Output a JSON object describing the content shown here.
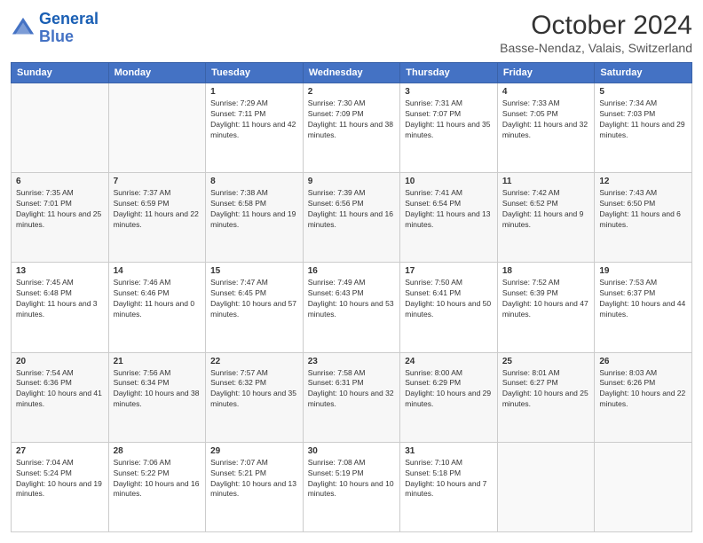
{
  "logo": {
    "line1": "General",
    "line2": "Blue"
  },
  "title": "October 2024",
  "subtitle": "Basse-Nendaz, Valais, Switzerland",
  "days_of_week": [
    "Sunday",
    "Monday",
    "Tuesday",
    "Wednesday",
    "Thursday",
    "Friday",
    "Saturday"
  ],
  "weeks": [
    [
      {
        "day": "",
        "info": ""
      },
      {
        "day": "",
        "info": ""
      },
      {
        "day": "1",
        "info": "Sunrise: 7:29 AM\nSunset: 7:11 PM\nDaylight: 11 hours and 42 minutes."
      },
      {
        "day": "2",
        "info": "Sunrise: 7:30 AM\nSunset: 7:09 PM\nDaylight: 11 hours and 38 minutes."
      },
      {
        "day": "3",
        "info": "Sunrise: 7:31 AM\nSunset: 7:07 PM\nDaylight: 11 hours and 35 minutes."
      },
      {
        "day": "4",
        "info": "Sunrise: 7:33 AM\nSunset: 7:05 PM\nDaylight: 11 hours and 32 minutes."
      },
      {
        "day": "5",
        "info": "Sunrise: 7:34 AM\nSunset: 7:03 PM\nDaylight: 11 hours and 29 minutes."
      }
    ],
    [
      {
        "day": "6",
        "info": "Sunrise: 7:35 AM\nSunset: 7:01 PM\nDaylight: 11 hours and 25 minutes."
      },
      {
        "day": "7",
        "info": "Sunrise: 7:37 AM\nSunset: 6:59 PM\nDaylight: 11 hours and 22 minutes."
      },
      {
        "day": "8",
        "info": "Sunrise: 7:38 AM\nSunset: 6:58 PM\nDaylight: 11 hours and 19 minutes."
      },
      {
        "day": "9",
        "info": "Sunrise: 7:39 AM\nSunset: 6:56 PM\nDaylight: 11 hours and 16 minutes."
      },
      {
        "day": "10",
        "info": "Sunrise: 7:41 AM\nSunset: 6:54 PM\nDaylight: 11 hours and 13 minutes."
      },
      {
        "day": "11",
        "info": "Sunrise: 7:42 AM\nSunset: 6:52 PM\nDaylight: 11 hours and 9 minutes."
      },
      {
        "day": "12",
        "info": "Sunrise: 7:43 AM\nSunset: 6:50 PM\nDaylight: 11 hours and 6 minutes."
      }
    ],
    [
      {
        "day": "13",
        "info": "Sunrise: 7:45 AM\nSunset: 6:48 PM\nDaylight: 11 hours and 3 minutes."
      },
      {
        "day": "14",
        "info": "Sunrise: 7:46 AM\nSunset: 6:46 PM\nDaylight: 11 hours and 0 minutes."
      },
      {
        "day": "15",
        "info": "Sunrise: 7:47 AM\nSunset: 6:45 PM\nDaylight: 10 hours and 57 minutes."
      },
      {
        "day": "16",
        "info": "Sunrise: 7:49 AM\nSunset: 6:43 PM\nDaylight: 10 hours and 53 minutes."
      },
      {
        "day": "17",
        "info": "Sunrise: 7:50 AM\nSunset: 6:41 PM\nDaylight: 10 hours and 50 minutes."
      },
      {
        "day": "18",
        "info": "Sunrise: 7:52 AM\nSunset: 6:39 PM\nDaylight: 10 hours and 47 minutes."
      },
      {
        "day": "19",
        "info": "Sunrise: 7:53 AM\nSunset: 6:37 PM\nDaylight: 10 hours and 44 minutes."
      }
    ],
    [
      {
        "day": "20",
        "info": "Sunrise: 7:54 AM\nSunset: 6:36 PM\nDaylight: 10 hours and 41 minutes."
      },
      {
        "day": "21",
        "info": "Sunrise: 7:56 AM\nSunset: 6:34 PM\nDaylight: 10 hours and 38 minutes."
      },
      {
        "day": "22",
        "info": "Sunrise: 7:57 AM\nSunset: 6:32 PM\nDaylight: 10 hours and 35 minutes."
      },
      {
        "day": "23",
        "info": "Sunrise: 7:58 AM\nSunset: 6:31 PM\nDaylight: 10 hours and 32 minutes."
      },
      {
        "day": "24",
        "info": "Sunrise: 8:00 AM\nSunset: 6:29 PM\nDaylight: 10 hours and 29 minutes."
      },
      {
        "day": "25",
        "info": "Sunrise: 8:01 AM\nSunset: 6:27 PM\nDaylight: 10 hours and 25 minutes."
      },
      {
        "day": "26",
        "info": "Sunrise: 8:03 AM\nSunset: 6:26 PM\nDaylight: 10 hours and 22 minutes."
      }
    ],
    [
      {
        "day": "27",
        "info": "Sunrise: 7:04 AM\nSunset: 5:24 PM\nDaylight: 10 hours and 19 minutes."
      },
      {
        "day": "28",
        "info": "Sunrise: 7:06 AM\nSunset: 5:22 PM\nDaylight: 10 hours and 16 minutes."
      },
      {
        "day": "29",
        "info": "Sunrise: 7:07 AM\nSunset: 5:21 PM\nDaylight: 10 hours and 13 minutes."
      },
      {
        "day": "30",
        "info": "Sunrise: 7:08 AM\nSunset: 5:19 PM\nDaylight: 10 hours and 10 minutes."
      },
      {
        "day": "31",
        "info": "Sunrise: 7:10 AM\nSunset: 5:18 PM\nDaylight: 10 hours and 7 minutes."
      },
      {
        "day": "",
        "info": ""
      },
      {
        "day": "",
        "info": ""
      }
    ]
  ]
}
